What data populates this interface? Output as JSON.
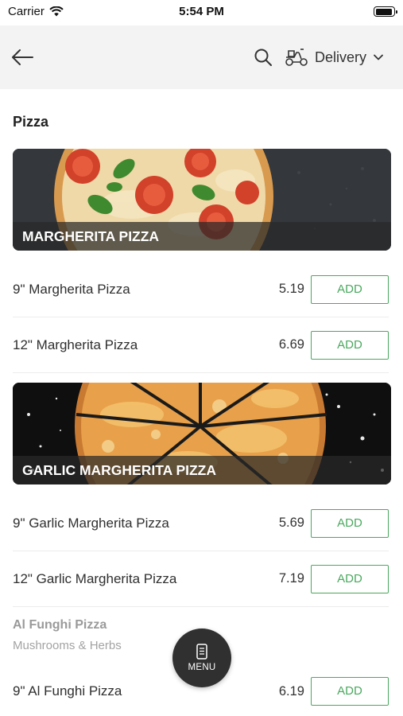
{
  "status_bar": {
    "carrier": "Carrier",
    "time": "5:54 PM",
    "battery_level": 0.95
  },
  "nav": {
    "back_icon": "arrow-left-icon",
    "search_icon": "search-icon",
    "delivery_icon": "scooter-icon",
    "delivery_label": "Delivery",
    "dropdown_icon": "chevron-down-icon"
  },
  "section": {
    "title": "Pizza"
  },
  "categories": [
    {
      "banner_title": "MARGHERITA PIZZA",
      "items": [
        {
          "name": "9\" Margherita Pizza",
          "price": "5.19",
          "button": "ADD"
        },
        {
          "name": "12\" Margherita Pizza",
          "price": "6.69",
          "button": "ADD"
        }
      ]
    },
    {
      "banner_title": "GARLIC MARGHERITA PIZZA",
      "items": [
        {
          "name": "9\" Garlic Margherita Pizza",
          "price": "5.69",
          "button": "ADD"
        },
        {
          "name": "12\" Garlic Margherita Pizza",
          "price": "7.19",
          "button": "ADD"
        }
      ]
    },
    {
      "title": "Al Funghi Pizza",
      "subtitle": "Mushrooms & Herbs",
      "items": [
        {
          "name": "9\" Al Funghi Pizza",
          "price": "6.19",
          "button": "ADD"
        }
      ]
    }
  ],
  "menu_button": {
    "label": "MENU",
    "icon": "phone-menu-icon"
  },
  "colors": {
    "accent": "#49a95d",
    "nav_background": "#f3f3f3",
    "fab_background": "#303030"
  }
}
